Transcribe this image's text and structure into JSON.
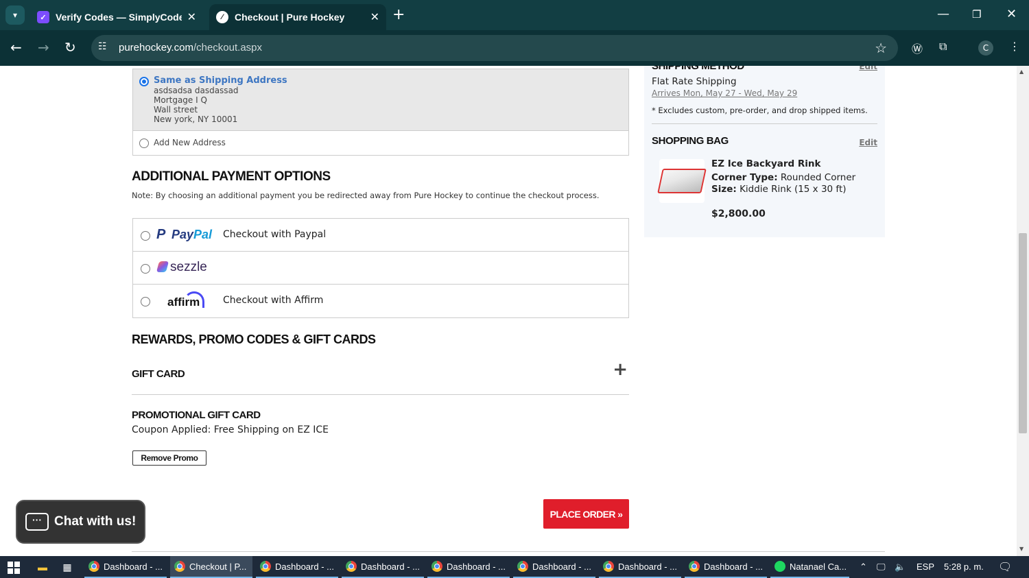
{
  "browser": {
    "tabs": [
      {
        "title": "Verify Codes — SimplyCodes",
        "favicon": "simplycodes-icon"
      },
      {
        "title": "Checkout | Pure Hockey",
        "favicon": "purehockey-icon",
        "active": true
      }
    ],
    "url_host": "purehockey.com",
    "url_path": "/checkout.aspx",
    "profile_initial": "C"
  },
  "billing": {
    "selected_title": "Same as Shipping Address",
    "address_lines": [
      "asdsadsa dasdassad",
      "Mortgage I Q",
      "Wall street",
      "New york, NY 10001"
    ],
    "add_new_label": "Add New Address"
  },
  "payment": {
    "heading": "ADDITIONAL PAYMENT OPTIONS",
    "note": "Note: By choosing an additional payment you be redirected away from Pure Hockey to continue the checkout process.",
    "options": [
      {
        "logo": "PayPal",
        "label": "Checkout with Paypal"
      },
      {
        "logo": "sezzle",
        "label": ""
      },
      {
        "logo": "affirm",
        "label": "Checkout with Affirm"
      }
    ]
  },
  "rewards": {
    "heading": "REWARDS, PROMO CODES & GIFT CARDS",
    "gift_card_label": "GIFT CARD",
    "promo_heading": "PROMOTIONAL GIFT CARD",
    "coupon_text": "Coupon Applied: Free Shipping on EZ ICE",
    "remove_label": "Remove Promo"
  },
  "place_order_label": "PLACE ORDER »",
  "chat_label": "Chat with us!",
  "sidebar": {
    "shipping_heading": "SHIPPING METHOD",
    "edit_label": "Edit",
    "shipping_method": "Flat Rate Shipping",
    "arrival": "Arrives Mon, May 27 - Wed, May 29",
    "exclusion_note": "* Excludes custom, pre-order, and drop shipped items.",
    "bag_heading": "SHOPPING BAG",
    "product": {
      "name": "EZ Ice Backyard Rink",
      "attr1_key": "Corner Type:",
      "attr1_val": "Rounded Corner",
      "attr2_key": "Size:",
      "attr2_val": "Kiddie Rink (15 x 30 ft)",
      "price": "$2,800.00"
    }
  },
  "taskbar": {
    "items": [
      {
        "label": "Dashboard - ...",
        "icon": "chrome-icon"
      },
      {
        "label": "Checkout | P...",
        "icon": "chrome-icon",
        "active": true
      },
      {
        "label": "Dashboard - ...",
        "icon": "chrome-icon"
      },
      {
        "label": "Dashboard - ...",
        "icon": "chrome-icon"
      },
      {
        "label": "Dashboard - ...",
        "icon": "chrome-icon"
      },
      {
        "label": "Dashboard - ...",
        "icon": "chrome-icon"
      },
      {
        "label": "Dashboard - ...",
        "icon": "chrome-icon"
      },
      {
        "label": "Dashboard - ...",
        "icon": "chrome-icon"
      },
      {
        "label": "Natanael Ca...",
        "icon": "spotify-icon"
      }
    ],
    "language": "ESP",
    "time": "5:28 p. m."
  },
  "colors": {
    "accent_red": "#e01e2b",
    "link_blue": "#3d76c2",
    "chrome_bg": "#0c3136"
  }
}
